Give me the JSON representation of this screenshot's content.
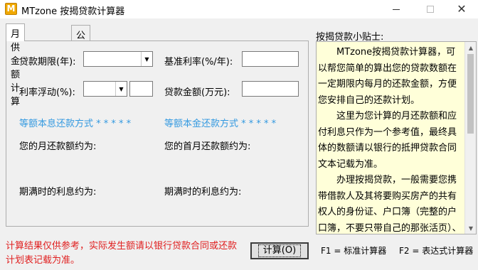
{
  "window": {
    "title": "MTzone 按揭贷款计算器",
    "icon_letter": "M",
    "minimize_icon": "minimize-icon",
    "maximize_icon": "maximize-icon",
    "close_icon": "close-icon"
  },
  "tabs": [
    {
      "label": "月供金额计算",
      "active": true
    },
    {
      "label": "公积金可贷金额计算",
      "active": false
    }
  ],
  "form": {
    "loan_term_label": "贷款期限(年):",
    "loan_term_value": "",
    "base_rate_label": "基准利率(%/年):",
    "base_rate_value": "",
    "rate_float_label": "利率浮动(%):",
    "rate_float_value": "",
    "rate_float_extra": "",
    "loan_amount_label": "贷款金额(万元):",
    "loan_amount_value": ""
  },
  "results": {
    "equal_installment_title": "等额本息还款方式 * * * * *",
    "equal_principal_title": "等额本金还款方式 * * * * *",
    "monthly_payment_label": "您的月还款额约为:",
    "first_month_payment_label": "您的首月还款额约为:",
    "interest_left_label": "期满时的利息约为:",
    "interest_right_label": "期满时的利息约为:"
  },
  "tips": {
    "title": "按揭贷款小贴士:",
    "paragraphs": [
      "MTzone按揭贷款计算器，可以帮您简单的算出您的贷款数额在一定期限内每月的还款金额，方便您安排自己的还款计划。",
      "这里为您计算的月还款额和应付利息只作为一个参考值，最终具体的数额请以银行的抵押贷款合同文本记载为准。",
      "办理按揭贷款，一般需要您携带借款人及其将要购买房产的共有权人的身份证、户口簿（完整的户口簿，不要只带自己的那张活页）、结婚证（若未婚、离异"
    ]
  },
  "footer": {
    "warning": "计算结果仅供参考，实际发生额请以银行贷款合同或还款计划表记载为准。",
    "calculate_button": "计算(O)",
    "hint_f1": "F1 = 标准计算器",
    "hint_f2": "F2 = 表达式计算器"
  },
  "colors": {
    "section_title": "#3399e0",
    "warning_text": "#e02020",
    "tips_background": "#ffffd9"
  }
}
